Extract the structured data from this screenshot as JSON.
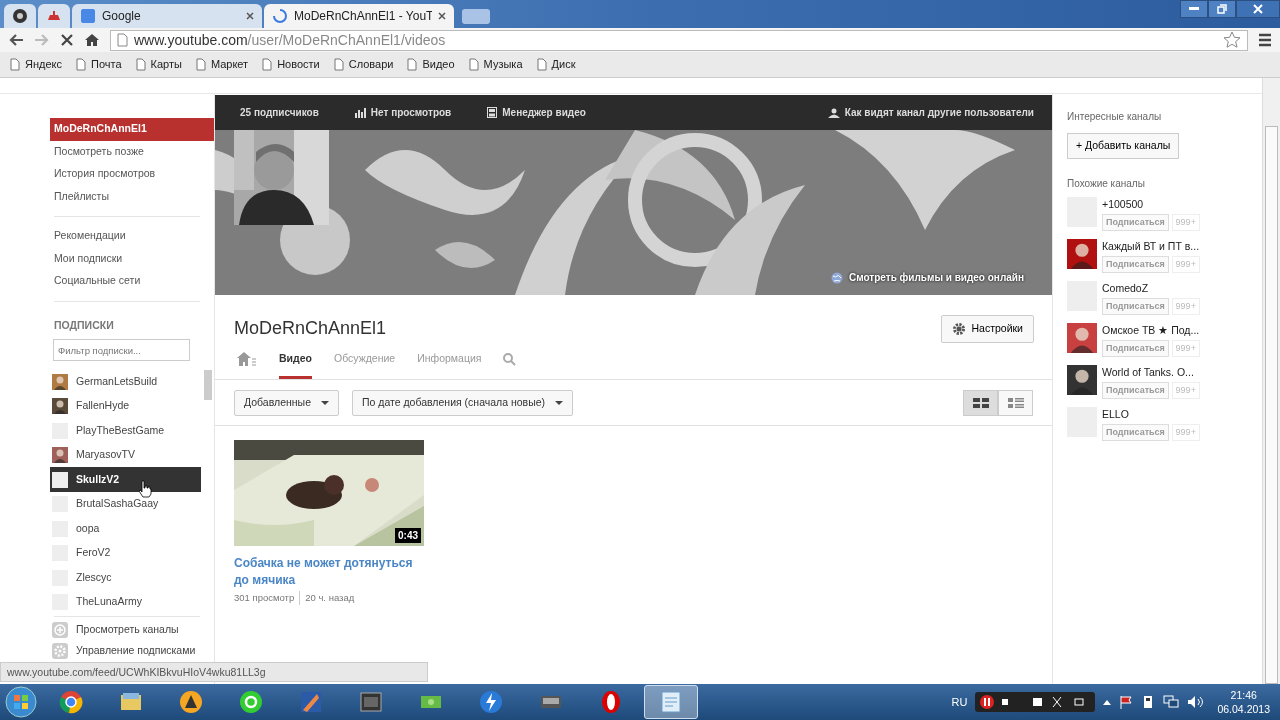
{
  "browser": {
    "tabs": [
      {
        "kind": "disc",
        "selected": false
      },
      {
        "kind": "red",
        "selected": false
      },
      {
        "kind": "google",
        "title": "Google",
        "selected": false
      },
      {
        "kind": "loading",
        "title": "MoDeRnChAnnEl1 - YouT",
        "selected": true
      }
    ],
    "url_host": "www.youtube.com",
    "url_path": "/user/MoDeRnChAnnEl1/videos",
    "bookmarks": [
      "Яндекс",
      "Почта",
      "Карты",
      "Маркет",
      "Новости",
      "Словари",
      "Видео",
      "Музыка",
      "Диск"
    ]
  },
  "sidebar": {
    "groups": [
      [
        {
          "label": "MoDeRnChAnnEl1",
          "selected": true
        },
        {
          "label": "Посмотреть позже",
          "selected": false
        },
        {
          "label": "История просмотров",
          "selected": false
        },
        {
          "label": "Плейлисты",
          "selected": false
        }
      ],
      [
        {
          "label": "Рекомендации",
          "selected": false
        },
        {
          "label": "Мои подписки",
          "selected": false
        },
        {
          "label": "Социальные сети",
          "selected": false
        }
      ]
    ],
    "subscriptions_heading": "ПОДПИСКИ",
    "filter": {
      "placeholder": "Фильтр подписки..."
    },
    "subscriptions": [
      {
        "name": "GermanLetsBuild",
        "color": "#b07a45",
        "selected": false
      },
      {
        "name": "FallenHyde",
        "color": "#5a4a3a",
        "selected": false
      },
      {
        "name": "PlayTheBestGame",
        "kind": "blank",
        "selected": false
      },
      {
        "name": "MaryasovTV",
        "color": "#a0605a",
        "selected": false
      },
      {
        "name": "SkullzV2",
        "kind": "blank",
        "selected": true
      },
      {
        "name": "BrutalSashaGaay",
        "kind": "blank",
        "selected": false
      },
      {
        "name": "oopa",
        "kind": "blank",
        "selected": false
      },
      {
        "name": "FeroV2",
        "kind": "blank",
        "selected": false
      },
      {
        "name": "Zlescyc",
        "kind": "blank",
        "selected": false
      },
      {
        "name": "TheLunaArmy",
        "kind": "blank",
        "selected": false
      }
    ],
    "footer": [
      {
        "kind": "plus",
        "label": "Просмотреть каналы"
      },
      {
        "kind": "gear",
        "label": "Управление подписками"
      }
    ]
  },
  "channel": {
    "stats": [
      {
        "kind": "plain",
        "label": "25 подписчиков"
      },
      {
        "kind": "chart",
        "label": "Нет просмотров"
      },
      {
        "kind": "film",
        "label": "Менеджер видео"
      }
    ],
    "view_as": "Как видят канал другие пользователи",
    "banner_link": "Смотреть фильмы и видео онлайн",
    "name": "MoDeRnChAnnEl1",
    "settings": "Настройки",
    "tabs": [
      {
        "kind": "home",
        "selected": false
      },
      {
        "kind": "text",
        "label": "Видео",
        "selected": true
      },
      {
        "kind": "text",
        "label": "Обсуждение",
        "selected": false
      },
      {
        "kind": "text",
        "label": "Информация",
        "selected": false
      },
      {
        "kind": "search",
        "selected": false
      }
    ],
    "filters": [
      "Добавленные",
      "По дате добавления (сначала новые)"
    ],
    "views": [
      {
        "kind": "grid",
        "selected": true
      },
      {
        "kind": "list",
        "selected": false
      }
    ],
    "videos": [
      {
        "duration": "0:43",
        "title": "Собачка не может дотянуться до мячика",
        "views": "301 просмотр",
        "age": "20 ч. назад"
      }
    ]
  },
  "right": {
    "heading": "Интересные каналы",
    "add_button": "+ Добавить каналы",
    "similar_heading": "Похожие каналы",
    "channels": [
      {
        "name": "+100500",
        "kind": "blank",
        "subscribe": "Подписаться",
        "count": "999+"
      },
      {
        "name": "Каждый ВТ и ПТ в...",
        "color": "#b01010",
        "subscribe": "Подписаться",
        "count": "999+"
      },
      {
        "name": "ComedoZ",
        "kind": "blank",
        "subscribe": "Подписаться",
        "count": "999+"
      },
      {
        "name": "Омское ТВ ★ Под...",
        "color": "#c84040",
        "subscribe": "Подписаться",
        "count": "999+"
      },
      {
        "name": "World of Tanks. O...",
        "color": "#333333",
        "subscribe": "Подписаться",
        "count": "999+"
      },
      {
        "name": "ELLO",
        "kind": "blank",
        "subscribe": "Подписаться",
        "count": "999+"
      }
    ]
  },
  "status_url": "www.youtube.com/feed/UCWhKIBkvuHIoV4wku81LL3g",
  "taskbar": {
    "apps": [
      {
        "kind": "chrome",
        "active": false
      },
      {
        "kind": "folder",
        "active": false
      },
      {
        "kind": "aimp",
        "active": false
      },
      {
        "kind": "mail",
        "active": false
      },
      {
        "kind": "game",
        "active": false
      },
      {
        "kind": "film",
        "active": false
      },
      {
        "kind": "money",
        "active": false
      },
      {
        "kind": "bolt",
        "active": false
      },
      {
        "kind": "device",
        "active": false
      },
      {
        "kind": "opera",
        "active": false
      },
      {
        "kind": "notes",
        "active": true
      }
    ],
    "language": "RU",
    "time": "21:46",
    "date": "06.04.2013"
  }
}
